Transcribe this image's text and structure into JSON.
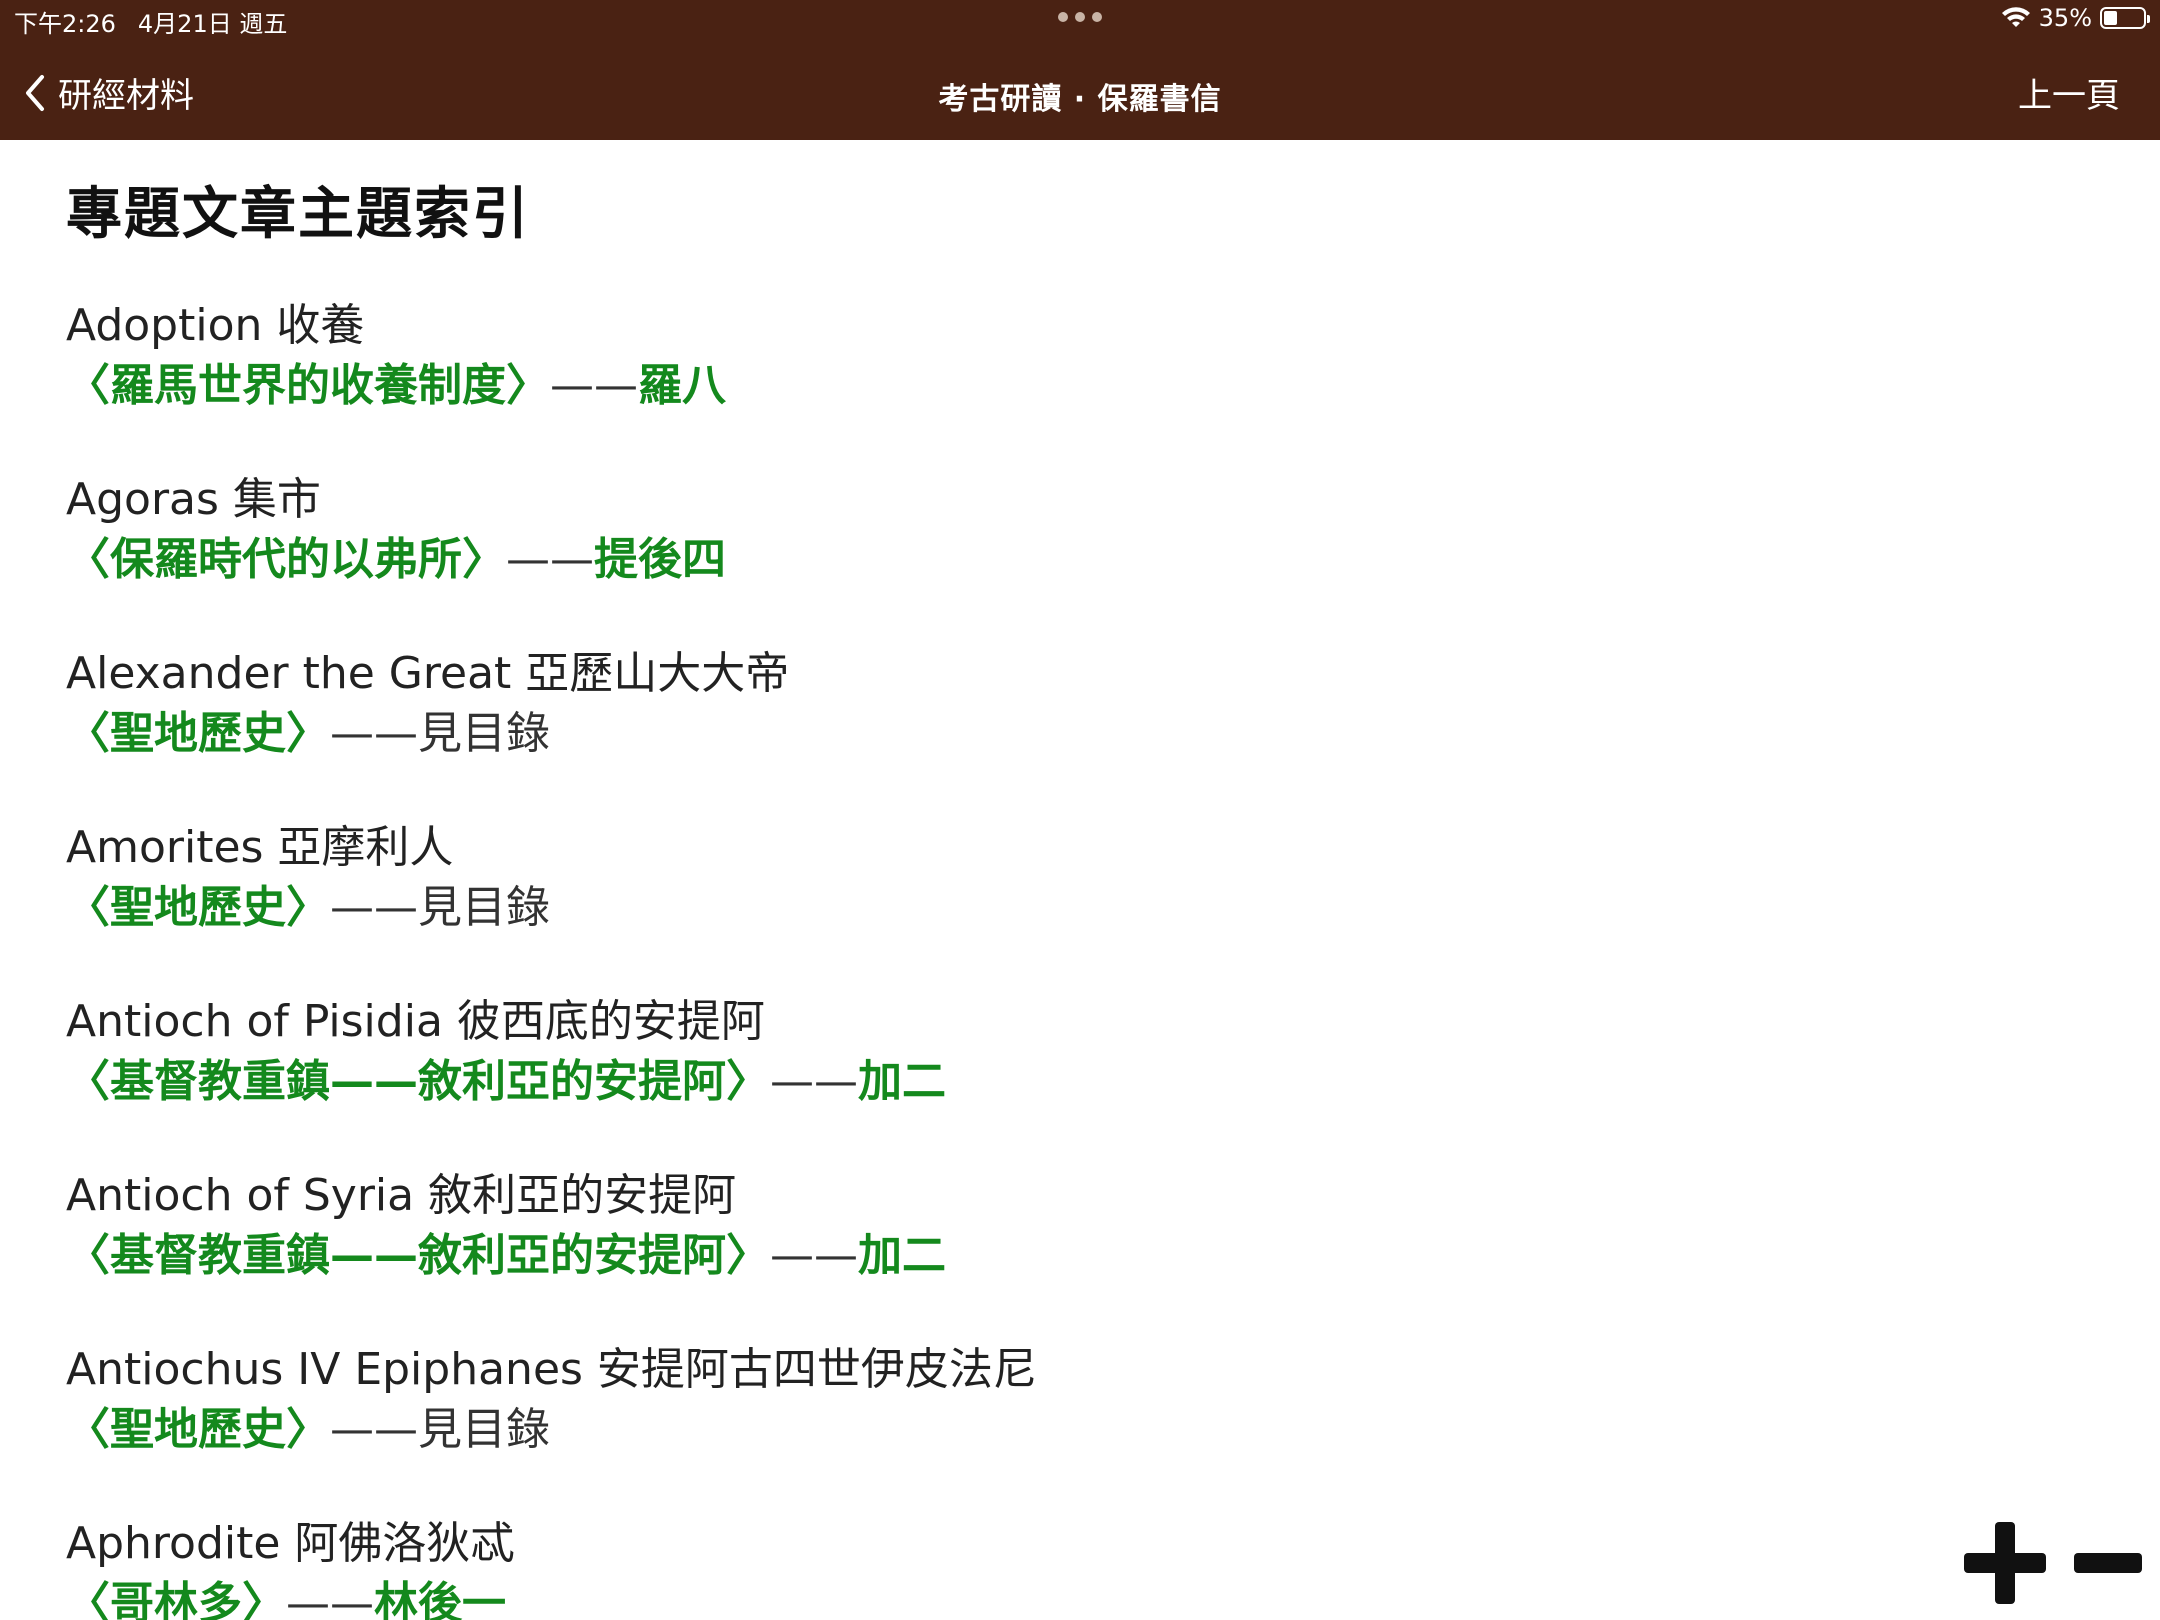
{
  "status_bar": {
    "time": "下午2:26",
    "date": "4月21日 週五",
    "battery_percent": "35%",
    "battery_level": 0.35
  },
  "nav": {
    "back_label": "研經材料",
    "title": "考古研讀 · 保羅書信",
    "prev_label": "上一頁"
  },
  "page": {
    "title": "專題文章主題索引"
  },
  "entries": [
    {
      "term": "Adoption 收養",
      "ref_title": "〈羅馬世界的收養制度〉",
      "dash": "——",
      "location": "羅八",
      "location_link": true
    },
    {
      "term": "Agoras 集市",
      "ref_title": "〈保羅時代的以弗所〉",
      "dash": "——",
      "location": "提後四",
      "location_link": true
    },
    {
      "term": "Alexander the Great 亞歷山大大帝",
      "ref_title": "〈聖地歷史〉",
      "dash": "——",
      "location": "見目錄",
      "location_link": false
    },
    {
      "term": "Amorites 亞摩利人",
      "ref_title": "〈聖地歷史〉",
      "dash": "——",
      "location": "見目錄",
      "location_link": false
    },
    {
      "term": "Antioch of Pisidia 彼西底的安提阿",
      "ref_title": "〈基督教重鎮——敘利亞的安提阿〉",
      "dash": "——",
      "location": "加二",
      "location_link": true
    },
    {
      "term": "Antioch of Syria 敘利亞的安提阿",
      "ref_title": "〈基督教重鎮——敘利亞的安提阿〉",
      "dash": "——",
      "location": "加二",
      "location_link": true
    },
    {
      "term": "Antiochus IV Epiphanes 安提阿古四世伊皮法尼",
      "ref_title": "〈聖地歷史〉",
      "dash": "——",
      "location": "見目錄",
      "location_link": false
    },
    {
      "term": "Aphrodite 阿佛洛狄忒",
      "ref_title": "〈哥林多〉",
      "dash": "——",
      "location": "林後一",
      "location_link": true
    }
  ],
  "zoom": {
    "in_icon": "plus-icon",
    "out_icon": "minus-icon"
  },
  "colors": {
    "header_bg": "#4a2213",
    "link_green": "#14891d"
  }
}
